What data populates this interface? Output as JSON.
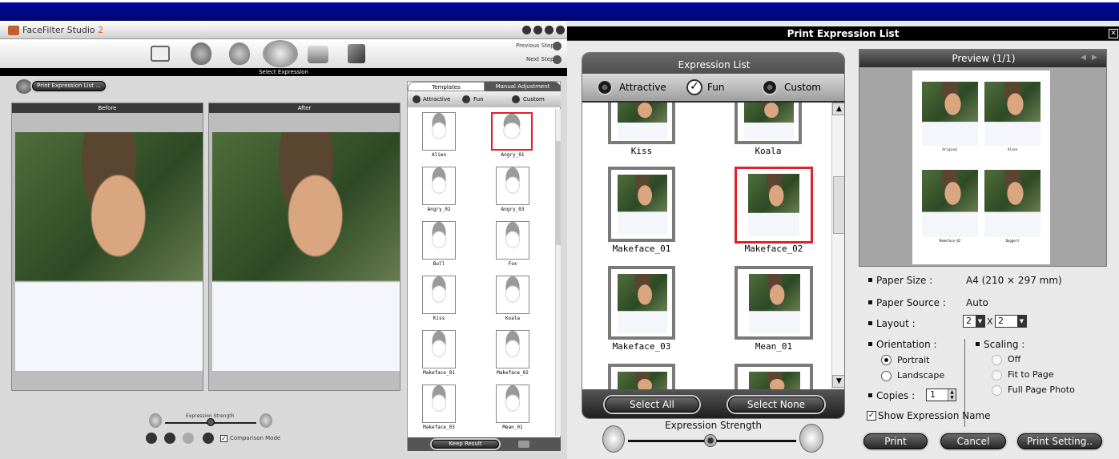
{
  "left_app": {
    "title_prefix": "FaceFilter Studio ",
    "title_version": "2",
    "previous_step": "Previous Step",
    "next_step": "Next Step",
    "section_title": "Select Expression",
    "print_list_btn": "Print Expression List ...",
    "before_label": "Before",
    "after_label": "After",
    "tabs": [
      "Templates",
      "Manual Adjustment"
    ],
    "filters": [
      "Attractive",
      "Fun",
      "Custom"
    ],
    "templates": [
      "Alien",
      "Angry_01",
      "Angry_02",
      "Angry_03",
      "Bull",
      "Fox",
      "Kiss",
      "Koala",
      "Makeface_01",
      "Makeface_02",
      "Makeface_03",
      "Mean_01"
    ],
    "expression_strength": "Expression Strength",
    "comparison_mode": "Comparison Mode",
    "keep_result": "Keep Result"
  },
  "dialog": {
    "title": "Print Expression List",
    "list_title": "Expression List",
    "filters": [
      "Attractive",
      "Fun",
      "Custom"
    ],
    "items": [
      "Kiss",
      "Koala",
      "Makeface_01",
      "Makeface_02",
      "Makeface_03",
      "Mean_01"
    ],
    "select_all": "Select All",
    "select_none": "Select None",
    "expression_strength": "Expression Strength",
    "preview_title": "Preview (1/1)",
    "preview_thumbs": [
      "Original",
      "Alien",
      "Makeface_02",
      "Doggert"
    ],
    "paper_size_label": "Paper Size :",
    "paper_size_value": "A4 (210 × 297 mm)",
    "paper_source_label": "Paper Source :",
    "paper_source_value": "Auto",
    "layout_label": "Layout :",
    "layout_cols": "2",
    "layout_x": "X",
    "layout_rows": "2",
    "orientation_label": "Orientation :",
    "portrait": "Portrait",
    "landscape": "Landscape",
    "scaling_label": "Scaling :",
    "scaling_off": "Off",
    "scaling_fit": "Fit to Page",
    "scaling_full": "Full Page Photo",
    "copies_label": "Copies :",
    "copies_value": "1",
    "show_name": "Show Expression Name",
    "print": "Print",
    "cancel": "Cancel",
    "print_setting": "Print Setting.."
  },
  "colors": {
    "titlebar_blue": "#000a8c",
    "selected_red": "#e0202a",
    "dialog_bg": "#e9e9e9"
  }
}
